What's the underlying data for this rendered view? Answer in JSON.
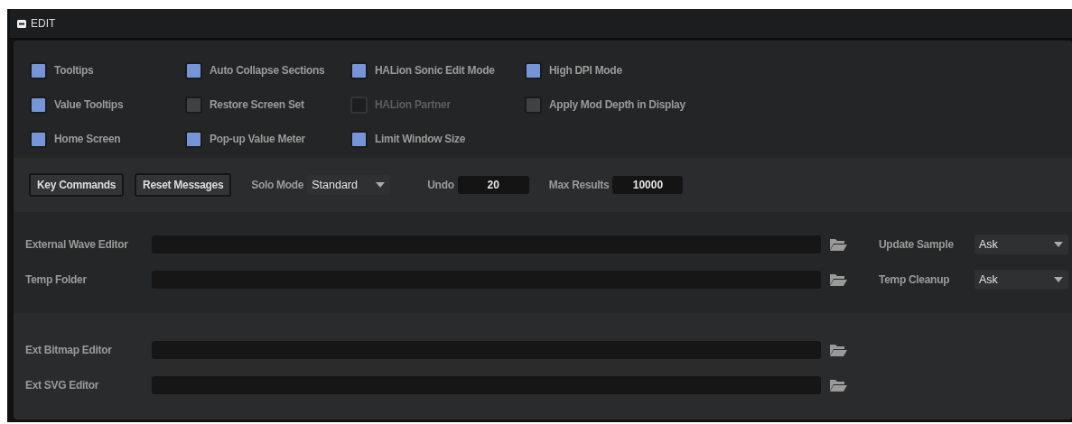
{
  "section": {
    "title": "EDIT",
    "expanded": true
  },
  "option_columns": [
    {
      "items": [
        {
          "label": "Tooltips",
          "checked": true,
          "disabled": false
        },
        {
          "label": "Value Tooltips",
          "checked": true,
          "disabled": false
        },
        {
          "label": "Home Screen",
          "checked": true,
          "disabled": false
        }
      ]
    },
    {
      "items": [
        {
          "label": "Auto Collapse Sections",
          "checked": true,
          "disabled": false
        },
        {
          "label": "Restore Screen Set",
          "checked": false,
          "disabled": false
        },
        {
          "label": "Pop-up Value Meter",
          "checked": true,
          "disabled": false
        }
      ]
    },
    {
      "items": [
        {
          "label": "HALion Sonic Edit Mode",
          "checked": true,
          "disabled": false
        },
        {
          "label": "HALion Partner",
          "checked": false,
          "disabled": true
        },
        {
          "label": "Limit Window Size",
          "checked": true,
          "disabled": false
        }
      ]
    },
    {
      "items": [
        {
          "label": "High DPI Mode",
          "checked": true,
          "disabled": false
        },
        {
          "label": "Apply Mod Depth in Display",
          "checked": false,
          "disabled": false
        }
      ]
    }
  ],
  "toolbar": {
    "buttons": [
      "Key Commands",
      "Reset Messages"
    ],
    "solo_mode": {
      "label": "Solo Mode",
      "value": "Standard"
    },
    "undo": {
      "label": "Undo",
      "value": "20"
    },
    "max_results": {
      "label": "Max Results",
      "value": "10000"
    }
  },
  "editor_paths": [
    {
      "label": "External Wave Editor",
      "option": {
        "label": "Update Sample",
        "value": "Ask"
      }
    },
    {
      "label": "Temp Folder",
      "option": {
        "label": "Temp Cleanup",
        "value": "Ask"
      }
    }
  ],
  "image_editor_paths": [
    {
      "label": "Ext Bitmap Editor"
    },
    {
      "label": "Ext SVG Editor"
    }
  ]
}
